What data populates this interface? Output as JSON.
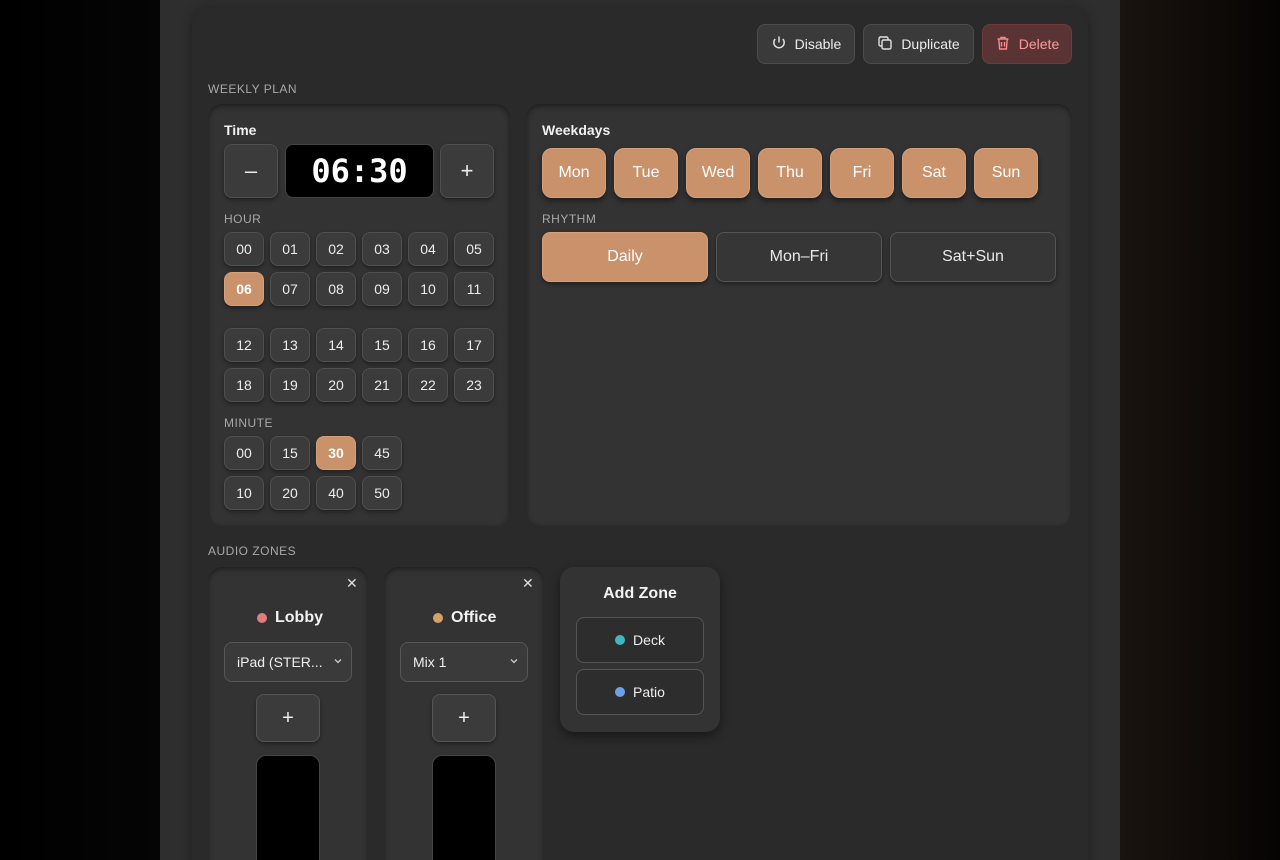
{
  "actions": {
    "disable_label": "Disable",
    "duplicate_label": "Duplicate",
    "delete_label": "Delete"
  },
  "weekly_plan": {
    "section_label": "WEEKLY PLAN",
    "time": {
      "title": "Time",
      "minus_label": "–",
      "plus_label": "+",
      "display": "06:30",
      "hour_label": "HOUR",
      "hours": [
        "00",
        "01",
        "02",
        "03",
        "04",
        "05",
        "06",
        "07",
        "08",
        "09",
        "10",
        "11",
        "12",
        "13",
        "14",
        "15",
        "16",
        "17",
        "18",
        "19",
        "20",
        "21",
        "22",
        "23"
      ],
      "selected_hour": "06",
      "minute_label": "MINUTE",
      "minutes": [
        "00",
        "15",
        "30",
        "45",
        "10",
        "20",
        "40",
        "50"
      ],
      "selected_minute": "30"
    },
    "weekdays": {
      "title": "Weekdays",
      "days": [
        "Mon",
        "Tue",
        "Wed",
        "Thu",
        "Fri",
        "Sat",
        "Sun"
      ],
      "rhythm_label": "RHYTHM",
      "rhythm_options": [
        "Daily",
        "Mon–Fri",
        "Sat+Sun"
      ],
      "selected_rhythm": "Daily"
    }
  },
  "audio_zones": {
    "section_label": "AUDIO ZONES",
    "zones": [
      {
        "name": "Lobby",
        "dot_color": "#e07e7e",
        "source": "iPad (STER...",
        "close_label": "✕",
        "plus_label": "+"
      },
      {
        "name": "Office",
        "dot_color": "#d9a066",
        "source": "Mix 1",
        "close_label": "✕",
        "plus_label": "+"
      }
    ],
    "add_zone": {
      "title": "Add Zone",
      "options": [
        {
          "name": "Deck",
          "dot_color": "#3fb8c4"
        },
        {
          "name": "Patio",
          "dot_color": "#6fa0e6"
        }
      ]
    }
  },
  "colors": {
    "accent": "#c9926a",
    "danger_text": "#ff9a9a"
  }
}
